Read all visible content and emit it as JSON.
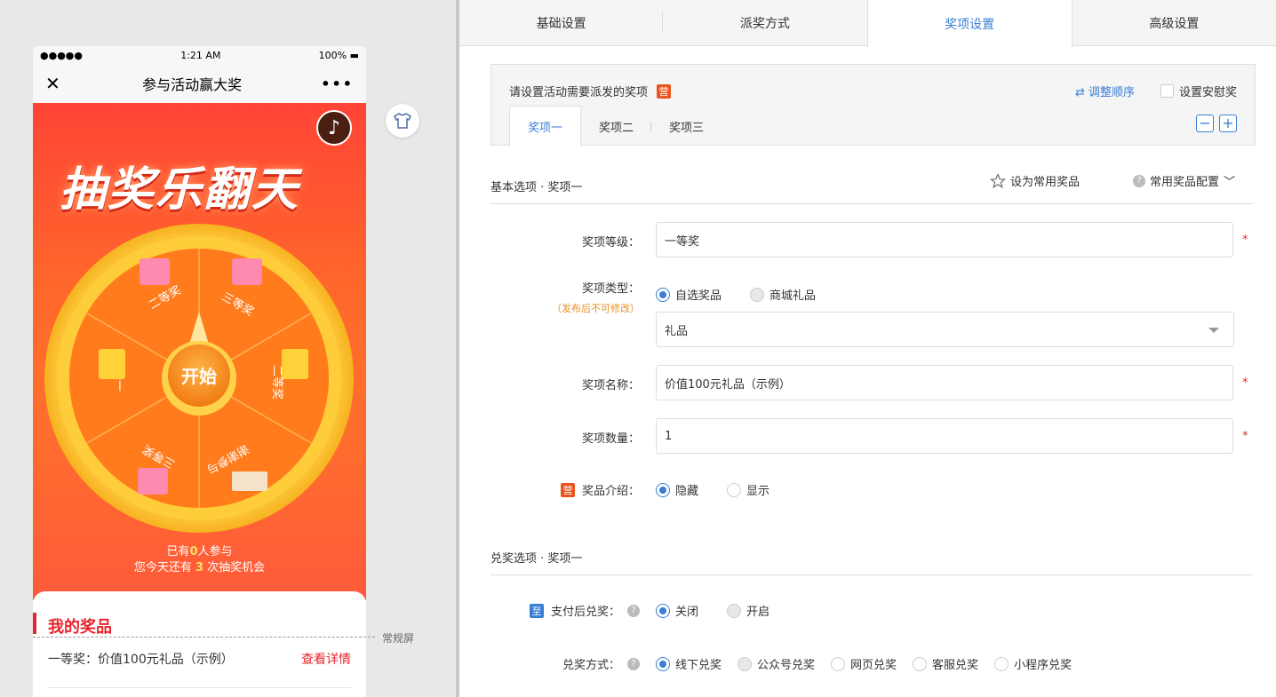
{
  "phone": {
    "status": {
      "signal": "●●●●●",
      "time": "1:21 AM",
      "battery": "100%"
    },
    "nav": {
      "close": "✕",
      "title": "参与活动赢大奖",
      "more": "•••"
    },
    "hero": {
      "title": "抽奖乐翻天",
      "wheel": {
        "start_label": "开始",
        "segments": [
          "二等奖",
          "三等奖",
          "二等奖",
          "谢谢参与",
          "三等奖",
          "一等奖"
        ]
      },
      "participants": {
        "prefix": "已有",
        "count": "0",
        "suffix": "人参与"
      },
      "chances": {
        "prefix": "您今天还有 ",
        "count": "3",
        "suffix": " 次抽奖机会"
      }
    },
    "prizes": {
      "title": "我的奖品",
      "row_text": "一等奖：价值100元礼品（示例）",
      "row_link": "查看详情"
    }
  },
  "screen_label": "常规屏",
  "tabs": [
    {
      "label": "基础设置",
      "active": false
    },
    {
      "label": "派奖方式",
      "active": false
    },
    {
      "label": "奖项设置",
      "active": true
    },
    {
      "label": "高级设置",
      "active": false
    }
  ],
  "panel": {
    "heading": "请设置活动需要派发的奖项",
    "ying_badge": "营",
    "adjust_order": "⇄ 调整顺序",
    "consolation": "设置安慰奖",
    "subtabs": [
      "奖项一",
      "奖项二",
      "奖项三"
    ],
    "minus": "−",
    "plus": "+"
  },
  "basic": {
    "section_title": "基本选项 · 奖项一",
    "fav_label": "设为常用奖品",
    "fav_config": "常用奖品配置",
    "level_label": "奖项等级：",
    "level_value": "一等奖",
    "type_label": "奖项类型：",
    "type_note": "（发布后不可修改）",
    "type_options": [
      "自选奖品",
      "商城礼品"
    ],
    "type_select": "礼品",
    "name_label": "奖项名称：",
    "name_value": "价值100元礼品（示例）",
    "qty_label": "奖项数量：",
    "qty_value": "1",
    "intro_label": "奖品介绍：",
    "intro_options": [
      "隐藏",
      "显示"
    ],
    "required": "*"
  },
  "redeem": {
    "section_title": "兑奖选项 · 奖项一",
    "zhi_badge": "至",
    "pay_label": "支付后兑奖：",
    "pay_options": [
      "关闭",
      "开启"
    ],
    "method_label": "兑奖方式：",
    "method_options": [
      "线下兑奖",
      "公众号兑奖",
      "网页兑奖",
      "客服兑奖",
      "小程序兑奖"
    ]
  },
  "colors": {
    "accent": "#3a7fd5",
    "brand": "#e8541e",
    "red": "#e6262d"
  }
}
